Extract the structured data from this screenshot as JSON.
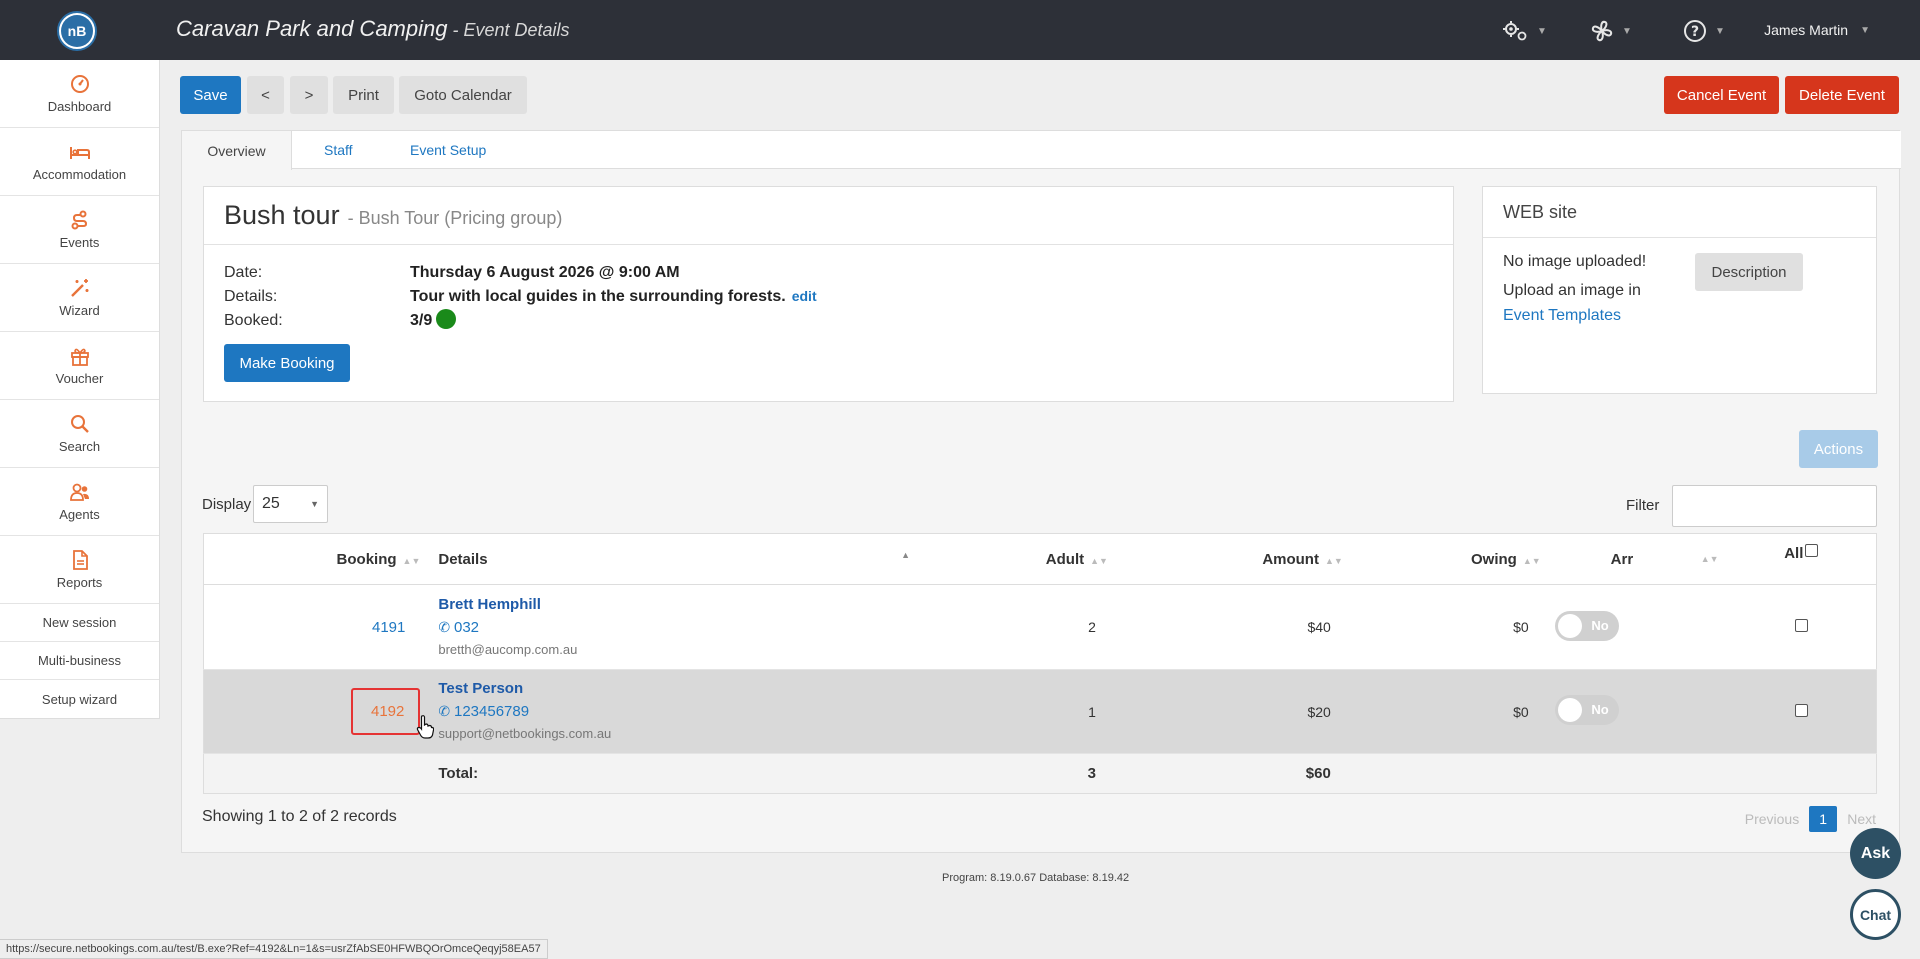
{
  "header": {
    "logo_text": "nB",
    "app_title": "Caravan Park and Camping",
    "title_separator": " - ",
    "page_subtitle": "Event Details",
    "user_name": "James Martin",
    "icons": [
      "settings-gears-icon",
      "fan-icon",
      "help-icon"
    ]
  },
  "sidebar": {
    "items": [
      {
        "label": "Dashboard",
        "icon": "dashboard-gauge-icon"
      },
      {
        "label": "Accommodation",
        "icon": "bed-icon"
      },
      {
        "label": "Events",
        "icon": "route-icon"
      },
      {
        "label": "Wizard",
        "icon": "magic-wand-icon"
      },
      {
        "label": "Voucher",
        "icon": "gift-icon"
      },
      {
        "label": "Search",
        "icon": "search-icon"
      },
      {
        "label": "Agents",
        "icon": "users-icon"
      },
      {
        "label": "Reports",
        "icon": "document-icon"
      }
    ],
    "links": [
      "New session",
      "Multi-business",
      "Setup wizard"
    ]
  },
  "toolbar": {
    "save_label": "Save",
    "prev_label": "<",
    "next_label": ">",
    "print_label": "Print",
    "calendar_label": "Goto Calendar",
    "cancel_event_label": "Cancel Event",
    "delete_event_label": "Delete Event"
  },
  "tabs": [
    {
      "label": "Overview",
      "active": true
    },
    {
      "label": "Staff",
      "active": false
    },
    {
      "label": "Event Setup",
      "active": false
    }
  ],
  "event": {
    "name": "Bush tour",
    "group": "- Bush Tour (Pricing group)",
    "date_label": "Date:",
    "date_value": "Thursday 6 August 2026 @ 9:00 AM",
    "details_label": "Details:",
    "details_value": "Tour with local guides in the surrounding forests.",
    "edit_label": "edit",
    "booked_label": "Booked:",
    "booked_value": "3/9",
    "booked_status_color": "#1a8a1a",
    "make_booking_label": "Make Booking"
  },
  "web_site": {
    "title": "WEB site",
    "no_image": "No image uploaded!",
    "upload_text": "Upload an image in",
    "templates_link": "Event Templates",
    "description_label": "Description"
  },
  "table_controls": {
    "display_label": "Display",
    "display_value": "25",
    "filter_label": "Filter",
    "filter_value": "",
    "actions_label": "Actions"
  },
  "table": {
    "columns": [
      "Booking",
      "Details",
      "Adult",
      "Amount",
      "Owing",
      "Arr",
      "All"
    ],
    "rows": [
      {
        "booking": "4191",
        "name": "Brett Hemphill",
        "phone": "032",
        "email": "bretth@aucomp.com.au",
        "adult": "2",
        "amount": "$40",
        "owing": "$0",
        "arr": "No"
      },
      {
        "booking": "4192",
        "name": "Test Person",
        "phone": "123456789",
        "email": "support@netbookings.com.au",
        "adult": "1",
        "amount": "$20",
        "owing": "$0",
        "arr": "No"
      }
    ],
    "total_label": "Total:",
    "total_adult": "3",
    "total_amount": "$60"
  },
  "pagination": {
    "showing": "Showing 1 to 2 of 2 records",
    "previous": "Previous",
    "current": "1",
    "next": "Next"
  },
  "footer": {
    "version": "Program: 8.19.0.67 Database: 8.19.42",
    "status_url": "https://secure.netbookings.com.au/test/B.exe?Ref=4192&Ln=1&s=usrZfAbSE0HFWBQOrOmceQeqyj58EA57"
  },
  "help": {
    "ask_label": "Ask",
    "chat_label": "Chat"
  },
  "colors": {
    "topbar": "#2d3038",
    "primary": "#1e77c1",
    "danger": "#d6361c",
    "sidebar_icon": "#e8733a",
    "owing_green": "#1f8a1f"
  }
}
